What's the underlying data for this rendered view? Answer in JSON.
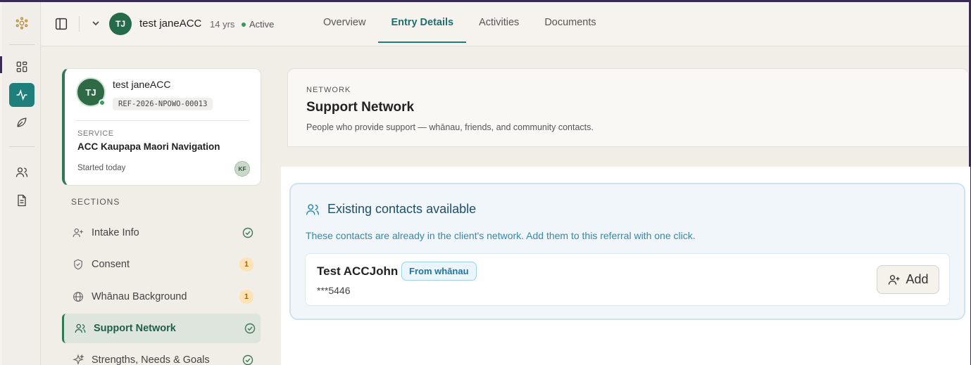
{
  "header": {
    "client_initials": "TJ",
    "client_name": "test janeACC",
    "age": "14 yrs",
    "status": "Active",
    "tabs": [
      {
        "label": "Overview"
      },
      {
        "label": "Entry Details"
      },
      {
        "label": "Activities"
      },
      {
        "label": "Documents"
      }
    ],
    "active_tab": "Entry Details"
  },
  "rail": {
    "icons": [
      "app-logo-icon",
      "dashboard-icon",
      "activity-icon",
      "leaf-icon",
      "people-icon",
      "document-icon"
    ],
    "active": "activity-icon"
  },
  "client_card": {
    "initials": "TJ",
    "name": "test janeACC",
    "reference": "REF-2026-NPOWO-00013",
    "service_label": "SERVICE",
    "service": "ACC Kaupapa Maori Navigation",
    "started": "Started today",
    "worker_initials": "KF"
  },
  "sections": {
    "label": "SECTIONS",
    "items": [
      {
        "label": "Intake Info",
        "icon": "person-plus-icon",
        "status": "complete"
      },
      {
        "label": "Consent",
        "icon": "shield-icon",
        "status": "pending",
        "badge": "1"
      },
      {
        "label": "Whānau Background",
        "icon": "globe-icon",
        "status": "pending",
        "badge": "1"
      },
      {
        "label": "Support Network",
        "icon": "people-icon",
        "status": "complete",
        "active": true
      },
      {
        "label": "Strengths, Needs & Goals",
        "icon": "sparkle-icon",
        "status": "complete"
      }
    ]
  },
  "network": {
    "kicker": "NETWORK",
    "title": "Support Network",
    "description": "People who provide support — whānau, friends, and community contacts."
  },
  "existing": {
    "title": "Existing contacts available",
    "description": "These contacts are already in the client's network. Add them to this referral with one click.",
    "contacts": [
      {
        "name": "Test ACCJohn",
        "badge": "From whānau",
        "phone": "***5446",
        "action": "Add"
      }
    ]
  },
  "colors": {
    "accent": "#1e7f7b",
    "brand_green": "#2f7a55",
    "info_blue": "#1f74a0",
    "warning": "#fde3b5"
  }
}
